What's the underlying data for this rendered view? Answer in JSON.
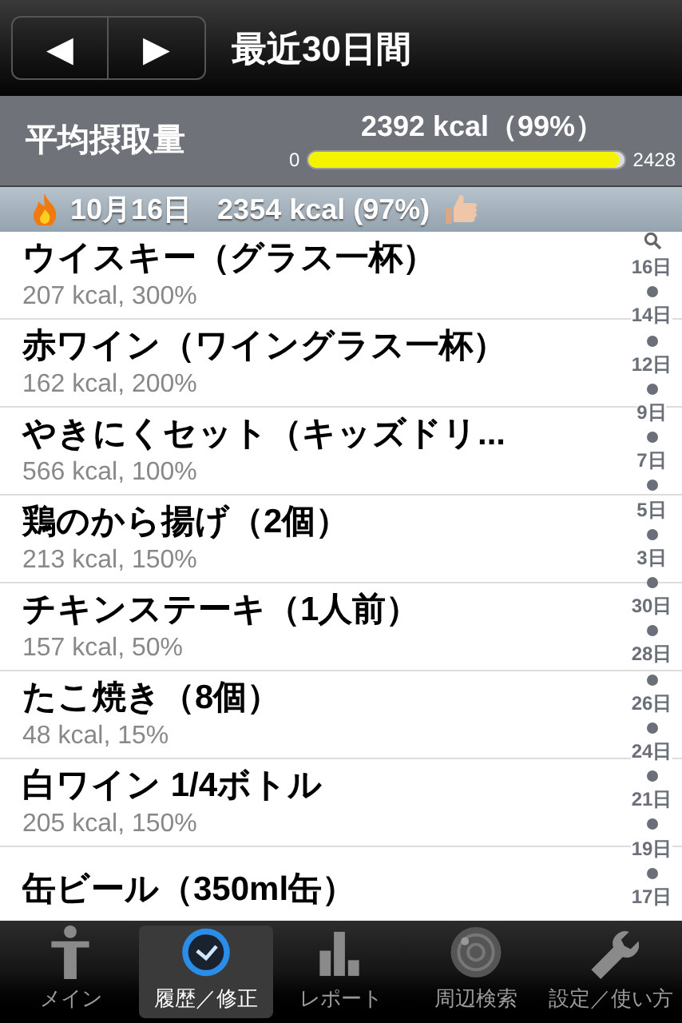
{
  "nav": {
    "back": "◀",
    "forward": "▶",
    "title": "最近30日間"
  },
  "summary": {
    "label": "平均摂取量",
    "value": "2392 kcal（99%）",
    "min": "0",
    "max": "2428",
    "level": 0.985
  },
  "section": {
    "date": "10月16日",
    "total": "2354 kcal (97%)"
  },
  "rows": [
    {
      "name": "ウイスキー（グラス一杯）",
      "detail": "207 kcal, 300%"
    },
    {
      "name": "赤ワイン（ワイングラス一杯）",
      "detail": "162 kcal, 200%"
    },
    {
      "name": "やきにくセット（キッズドリ...",
      "detail": "566 kcal, 100%"
    },
    {
      "name": "鶏のから揚げ（2個）",
      "detail": "213 kcal, 150%"
    },
    {
      "name": "チキンステーキ（1人前）",
      "detail": "157 kcal, 50%"
    },
    {
      "name": "たこ焼き（8個）",
      "detail": "48 kcal, 15%"
    },
    {
      "name": "白ワイン 1/4ボトル",
      "detail": "205 kcal, 150%"
    },
    {
      "name": "缶ビール（350ml缶）",
      "detail": ""
    }
  ],
  "index": [
    "16日",
    "14日",
    "12日",
    "9日",
    "7日",
    "5日",
    "3日",
    "30日",
    "28日",
    "26日",
    "24日",
    "21日",
    "19日",
    "17日"
  ],
  "tabs": [
    {
      "label": "メイン",
      "selected": false,
      "kind": "person"
    },
    {
      "label": "履歴／修正",
      "selected": true,
      "kind": "clock"
    },
    {
      "label": "レポート",
      "selected": false,
      "kind": "chart"
    },
    {
      "label": "周辺検索",
      "selected": false,
      "kind": "radar"
    },
    {
      "label": "設定／使い方",
      "selected": false,
      "kind": "wrench"
    }
  ]
}
